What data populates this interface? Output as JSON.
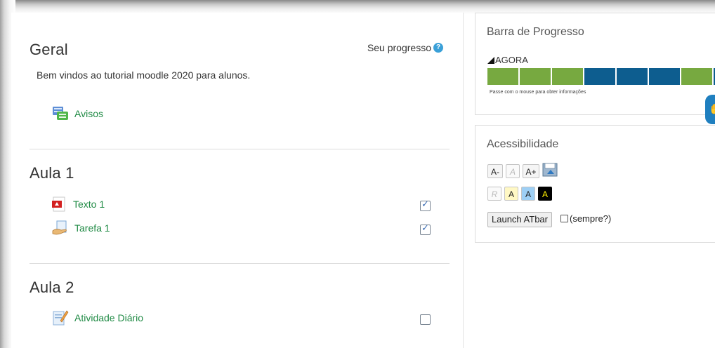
{
  "course": {
    "sections": [
      {
        "title": "Geral",
        "summary": "Bem vindos ao tutorial moodle 2020 para alunos.",
        "activities": [
          {
            "name": "Avisos",
            "icon": "forum-icon",
            "completion": null
          }
        ]
      },
      {
        "title": "Aula 1",
        "activities": [
          {
            "name": "Texto 1",
            "icon": "pdf-icon",
            "completion": "done"
          },
          {
            "name": "Tarefa 1",
            "icon": "assignment-icon",
            "completion": "done"
          }
        ]
      },
      {
        "title": "Aula 2",
        "activities": [
          {
            "name": "Atividade Diário",
            "icon": "journal-icon",
            "completion": "not-done"
          }
        ]
      }
    ],
    "progress_label": "Seu progresso",
    "help_symbol": "?"
  },
  "progress_block": {
    "title": "Barra de Progresso",
    "now_label": "AGORA",
    "segments": [
      "#77a940",
      "#77a940",
      "#77a940",
      "#0d5d8f",
      "#0d5d8f",
      "#0d5d8f",
      "#77a940",
      "#0d5d8f"
    ],
    "hint": "Passe com o mouse para obter informações",
    "colors": {
      "completed": "#77a940",
      "pending": "#0d5d8f"
    }
  },
  "accessibility_block": {
    "title": "Acessibilidade",
    "decrease_label": "A-",
    "reset_label": "A",
    "increase_label": "A+",
    "reset_colour_label": "R",
    "scheme_labels": [
      "A",
      "A",
      "A"
    ],
    "launch_label": "Launch ATbar",
    "always_label": "(sempre?)"
  }
}
